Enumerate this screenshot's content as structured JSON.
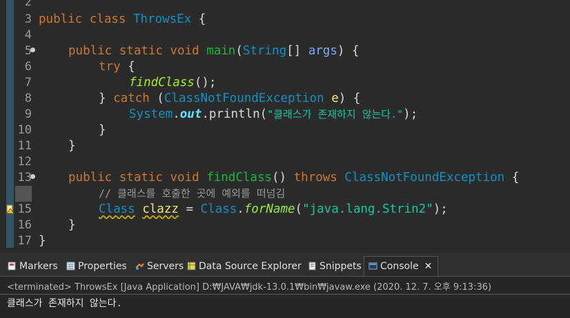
{
  "editor": {
    "lines": [
      {
        "n": "2"
      },
      {
        "n": "3",
        "t": [
          "public class ",
          "ThrowsEx",
          " {"
        ]
      },
      {
        "n": "4"
      },
      {
        "n": "5",
        "t": [
          "public static void ",
          "main",
          "(",
          "String",
          "[] ",
          "args",
          ") {"
        ]
      },
      {
        "n": "6",
        "t": [
          "try {"
        ]
      },
      {
        "n": "7",
        "t": [
          "findClass",
          "();"
        ]
      },
      {
        "n": "8",
        "t": [
          "} ",
          "catch (",
          "ClassNotFoundException",
          " ",
          "e",
          ") {"
        ]
      },
      {
        "n": "9",
        "t": [
          "System",
          ".",
          "out",
          ".println(",
          "\"클래스가 존재하지 않는다.\"",
          ");"
        ]
      },
      {
        "n": "10",
        "t": [
          "}"
        ]
      },
      {
        "n": "11",
        "t": [
          "}"
        ]
      },
      {
        "n": "12"
      },
      {
        "n": "13",
        "t": [
          "public static void ",
          "findClass",
          "() ",
          "throws ",
          "ClassNotFoundException",
          " {"
        ]
      },
      {
        "n": "14",
        "t": [
          "// 클래스를 호출한 곳에 예외를 떠넘김"
        ]
      },
      {
        "n": "15",
        "t": [
          "Class",
          " ",
          "clazz",
          " = ",
          "Class",
          ".",
          "forName",
          "(",
          "\"java.lang.Strin2\"",
          ");"
        ]
      },
      {
        "n": "16",
        "t": [
          "}"
        ]
      },
      {
        "n": "17",
        "t": [
          "}"
        ]
      }
    ]
  },
  "tabs": [
    {
      "label": "Markers",
      "icon": "markers-icon"
    },
    {
      "label": "Properties",
      "icon": "properties-icon"
    },
    {
      "label": "Servers",
      "icon": "servers-icon"
    },
    {
      "label": "Data Source Explorer",
      "icon": "data-source-explorer-icon"
    },
    {
      "label": "Snippets",
      "icon": "snippets-icon"
    },
    {
      "label": "Console",
      "icon": "console-icon",
      "active": true,
      "close": "✕"
    }
  ],
  "console": {
    "status": "<terminated> ThrowsEx [Java Application] D:₩JAVA₩jdk-13.0.1₩bin₩javaw.exe  (2020. 12. 7. 오후 9:13:36)",
    "output": "클래스가 존재하지 않는다."
  }
}
